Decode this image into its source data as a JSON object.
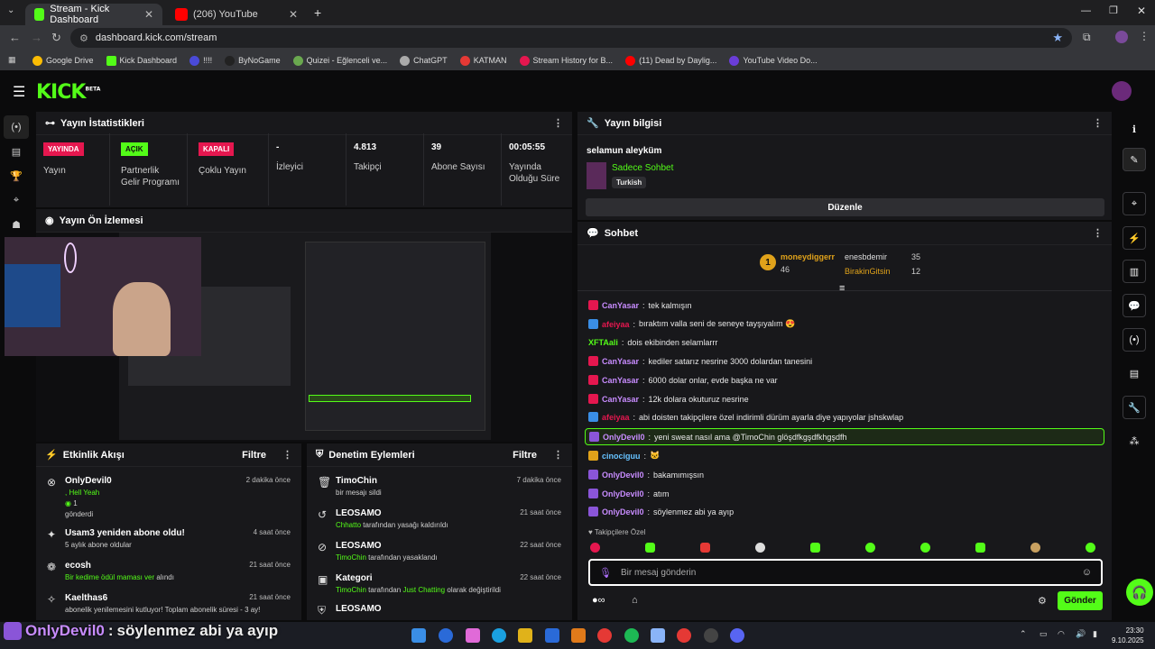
{
  "browser": {
    "tabs": [
      {
        "label": "Stream - Kick Dashboard"
      },
      {
        "label": "(206) YouTube"
      }
    ],
    "url": "dashboard.kick.com/stream",
    "bookmarks": [
      "Google Drive",
      "Kick Dashboard",
      "!!!!",
      "ByNoGame",
      "Quizei - Eğlenceli ve...",
      "ChatGPT",
      "KATMAN",
      "Stream History for B...",
      "(11) Dead by Daylig...",
      "YouTube Video Do..."
    ]
  },
  "kick": {
    "logo": "KICK",
    "beta": "BETA"
  },
  "stats": {
    "title": "Yayın İstatistikleri",
    "items": [
      {
        "badge": "YAYINDA",
        "label": "Yayın",
        "color": "#e5174f"
      },
      {
        "badge": "AÇIK",
        "label": "Partnerlik Gelir Programı",
        "color": "#53fc18"
      },
      {
        "badge": "KAPALI",
        "label": "Çoklu Yayın",
        "color": "#e5174f"
      },
      {
        "value": "-",
        "label": "İzleyici"
      },
      {
        "value": "4.813",
        "label": "Takipçi"
      },
      {
        "value": "39",
        "label": "Abone Sayısı"
      },
      {
        "value": "00:05:55",
        "label": "Yayında Olduğu Süre"
      }
    ]
  },
  "preview": {
    "title": "Yayın Ön İzlemesi"
  },
  "activity": {
    "title": "Etkinlik Akışı",
    "filter": "Filtre",
    "items": [
      {
        "name": "OnlyDevil0",
        "sub": ", Hell Yeah",
        "extra": "1",
        "extra2": "gönderdi",
        "time": "2 dakika önce"
      },
      {
        "name": "Usam3 yeniden abone oldu!",
        "sub": "5 aylık abone oldular",
        "time": "4 saat önce"
      },
      {
        "name": "ecosh",
        "sub": "Bir kedime ödül maması ver",
        "sub2": "alındı",
        "time": "21 saat önce"
      },
      {
        "name": "Kaelthas6",
        "sub": "abonelik yenilemesini kutluyor! Toplam abonelik süresi - 3 ay!",
        "time": "21 saat önce"
      }
    ]
  },
  "moderation": {
    "title": "Denetim Eylemleri",
    "filter": "Filtre",
    "items": [
      {
        "name": "TimoChin",
        "sub": "bir mesajı sildi",
        "time": "7 dakika önce"
      },
      {
        "name": "LEOSAMO",
        "hl": "Chhatto",
        "sub": "tarafından yasağı kaldırıldı",
        "time": "21 saat önce"
      },
      {
        "name": "LEOSAMO",
        "hl": "TimoChin",
        "sub": "tarafından yasaklandı",
        "time": "22 saat önce"
      },
      {
        "name": "Kategori",
        "hl": "TimoChin",
        "sub": "tarafından",
        "hl2": "Just Chatting",
        "sub2": "olarak değiştirildi",
        "time": "22 saat önce"
      },
      {
        "name": "LEOSAMO",
        "time": ""
      }
    ]
  },
  "info": {
    "title": "Yayın bilgisi",
    "stream_title": "selamun aleyküm",
    "category": "Sadece Sohbet",
    "lang": "Turkish",
    "edit": "Düzenle"
  },
  "chat": {
    "title": "Sohbet",
    "top": [
      {
        "rank": "1",
        "name": "moneydiggerr",
        "count": "46"
      },
      {
        "name": "enesbdemir",
        "count": "35"
      },
      {
        "name": "BirakinGitsin",
        "count": "12"
      }
    ],
    "messages": [
      {
        "user": "CanYasar",
        "color": "#c88cff",
        "text": "tek kalmışın"
      },
      {
        "user": "afeiyaa",
        "color": "#e5174f",
        "text": "bıraktım valla seni de seneye tayşıyalım 😍"
      },
      {
        "user": "XFTAali",
        "color": "#53fc18",
        "text": "dois ekibinden selamlarrr"
      },
      {
        "user": "CanYasar",
        "color": "#c88cff",
        "text": "kediler satarız nesrine 3000 dolardan tanesini"
      },
      {
        "user": "CanYasar",
        "color": "#c88cff",
        "text": "6000 dolar onlar, evde başka ne var"
      },
      {
        "user": "CanYasar",
        "color": "#c88cff",
        "text": "12k dolara okuturuz nesrine"
      },
      {
        "user": "afeiyaa",
        "color": "#e5174f",
        "text": "abi doisten takipçilere özel indirimli dürüm ayarla diye yapıyolar jshskwlap"
      },
      {
        "user": "OnlyDevil0",
        "color": "#c88cff",
        "text": "yeni sweat nasıl ama @TimoChin glöşdfkgşdfkhgşdfh",
        "highlight": true
      },
      {
        "user": "cinociguu",
        "color": "#66c2ff",
        "text": "🐱"
      },
      {
        "user": "OnlyDevil0",
        "color": "#c88cff",
        "text": "bakamımışsın"
      },
      {
        "user": "OnlyDevil0",
        "color": "#c88cff",
        "text": "atım"
      },
      {
        "user": "OnlyDevil0",
        "color": "#c88cff",
        "text": "söylenmez abi ya ayıp"
      }
    ],
    "followers_label": "Takipçilere Özel",
    "placeholder": "Bir mesaj gönderin",
    "send": "Gönder"
  },
  "overlay": {
    "user": "OnlyDevil0",
    "text": "söylenmez abi ya ayıp"
  },
  "clock": {
    "time": "23:30",
    "date": "9.10.2025"
  },
  "colors": {
    "accent": "#53fc18",
    "live": "#e5174f",
    "panel": "#18181b"
  }
}
